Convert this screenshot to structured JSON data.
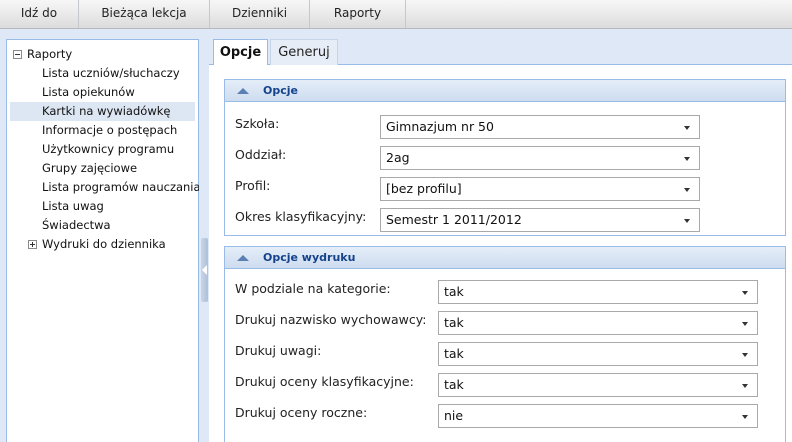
{
  "menu": [
    "Idź do",
    "Bieżąca lekcja",
    "Dzienniki",
    "Raporty"
  ],
  "tree": {
    "root_label": "Raporty",
    "children": [
      "Lista uczniów/słuchaczy",
      "Lista opiekunów",
      "Kartki na wywiadówkę",
      "Informacje o postępach",
      "Użytkownicy programu",
      "Grupy zajęciowe",
      "Lista programów nauczania",
      "Lista uwag",
      "Świadectwa"
    ],
    "selected_index": 2,
    "collapsed_child": "Wydruki do dziennika"
  },
  "tabs": {
    "active": "Opcje",
    "other": "Generuj"
  },
  "options": {
    "title": "Opcje",
    "rows": [
      {
        "label": "Szkoła:",
        "value": "Gimnazjum nr 50"
      },
      {
        "label": "Oddział:",
        "value": "2ag"
      },
      {
        "label": "Profil:",
        "value": "[bez profilu]"
      },
      {
        "label": "Okres klasyfikacyjny:",
        "value": "Semestr 1 2011/2012"
      }
    ]
  },
  "print_options": {
    "title": "Opcje wydruku",
    "rows": [
      {
        "label": "W podziale na kategorie:",
        "value": "tak"
      },
      {
        "label": "Drukuj nazwisko wychowawcy:",
        "value": "tak"
      },
      {
        "label": "Drukuj uwagi:",
        "value": "tak"
      },
      {
        "label": "Drukuj oceny klasyfikacyjne:",
        "value": "tak"
      },
      {
        "label": "Drukuj oceny roczne:",
        "value": "nie"
      }
    ]
  },
  "colors": {
    "panel_border": "#99bbe8",
    "header_text": "#15428b",
    "background": "#dfe8f6"
  }
}
